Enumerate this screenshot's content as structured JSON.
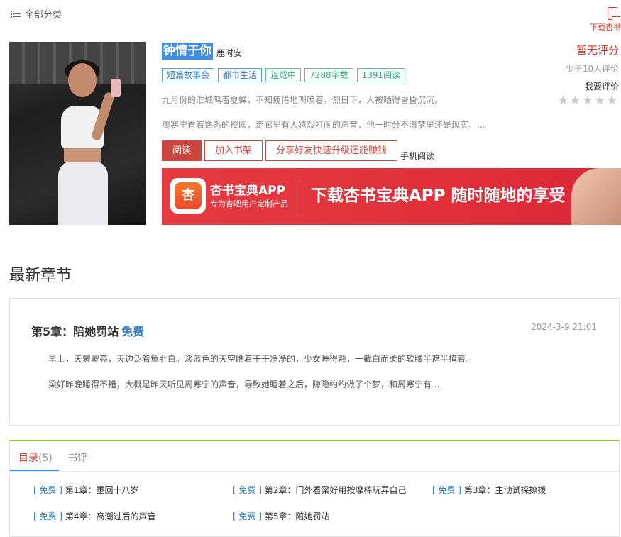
{
  "header": {
    "category_label": "全部分类",
    "download_label": "下载杏书"
  },
  "book": {
    "title": "钟情于你",
    "author": "鹿时安",
    "tags": [
      "短篇故事会",
      "都市生活",
      "连载中",
      "7288字数",
      "1391阅读"
    ],
    "desc1": "九月份的淮城鸣着夏蝉，不知疲倦地叫唤着，烈日下，人被晒得昏昏沉沉。",
    "desc2": "周寒宁看着熟悉的校园，走廊里有人嬉戏打闹的声音，他一时分不清梦里还是现实。...",
    "read_button": "阅读",
    "shelf_button": "加入书架",
    "share_button": "分享好友快速升级还能赚钱",
    "mobile_read": "手机阅读"
  },
  "rating": {
    "score": "暂无评分",
    "few": "少于10人评价",
    "want": "我要评价",
    "stars": "★★★★★"
  },
  "banner": {
    "logo_char": "杏",
    "app_name": "杏书宝典APP",
    "app_sub": "专为杏吧用户定制产品",
    "slogan": "下载杏书宝典APP 随时随地的享受"
  },
  "latest": {
    "section_title": "最新章节",
    "chapter_title": "第5章：陪她罚站",
    "free_tag": "免费",
    "date": "2024-3-9 21:01",
    "p1": "早上，天蒙蒙亮，天边泛着鱼肚白。淡蓝色的天空瞧着干干净净的，少女睡得熟，一截白而柔的软腰半遮半掩着。",
    "p2": "梁好昨晚睡得不错，大概是昨天听见周寒宁的声音，导致她睡着之后，隐隐约约做了个梦，和周寒宁有 ..."
  },
  "catalog": {
    "tab_catalog": "目录",
    "tab_count": "(5)",
    "tab_review": "书评",
    "free_tag": "[ 免费 ]",
    "chapters": [
      "第1章：重回十八岁",
      "第2章：门外看梁好用按摩棒玩弄自己",
      "第3章：主动试探撩拨",
      "第4章：高潮过后的声音",
      "第5章：陪她罚站"
    ]
  },
  "colors": {
    "accent_red": "#d0342c",
    "link_blue": "#2f7dc0",
    "catalog_top": "#9ac23c"
  }
}
